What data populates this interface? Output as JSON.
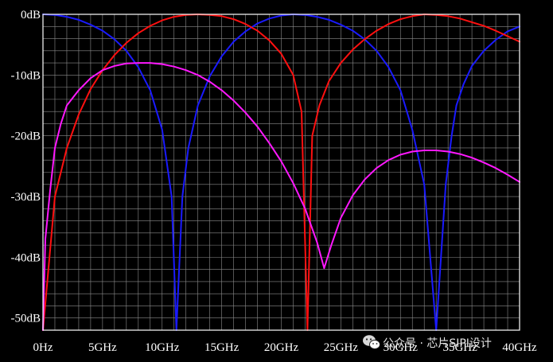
{
  "chart_data": {
    "type": "line",
    "title": "",
    "xlabel": "",
    "ylabel": "",
    "xlim": [
      0,
      40
    ],
    "ylim": [
      -52,
      0
    ],
    "x_unit": "GHz",
    "y_unit": "dB",
    "grid": true,
    "legend": "none",
    "x_ticks": [
      {
        "value": 0,
        "label": "0Hz"
      },
      {
        "value": 5,
        "label": "5GHz"
      },
      {
        "value": 10,
        "label": "10GHz"
      },
      {
        "value": 15,
        "label": "15GHz"
      },
      {
        "value": 20,
        "label": "20GHz"
      },
      {
        "value": 25,
        "label": "25GHz"
      },
      {
        "value": 30,
        "label": "30GHz"
      },
      {
        "value": 35,
        "label": "35GHz"
      },
      {
        "value": 40,
        "label": "40GHz"
      }
    ],
    "y_ticks": [
      {
        "value": 0,
        "label": "0dB"
      },
      {
        "value": -10,
        "label": "-10dB"
      },
      {
        "value": -20,
        "label": "-20dB"
      },
      {
        "value": -30,
        "label": "-30dB"
      },
      {
        "value": -40,
        "label": "-40dB"
      },
      {
        "value": -50,
        "label": "-50dB"
      }
    ],
    "series": [
      {
        "color": "#1a1aff",
        "x": [
          0,
          1,
          2,
          3,
          4,
          5,
          6,
          7,
          8,
          9,
          10,
          10.8,
          11.2,
          11.7,
          12.2,
          13,
          14,
          15,
          16,
          17,
          18,
          19,
          20,
          21,
          22,
          23,
          24,
          25,
          26,
          27,
          28,
          29,
          30,
          31,
          32,
          33,
          33.8,
          34.3,
          34.7,
          35.3,
          36,
          37,
          38,
          39,
          40
        ],
        "y": [
          0,
          -0.1,
          -0.4,
          -0.9,
          -1.7,
          -2.7,
          -4.1,
          -6.0,
          -8.7,
          -12.5,
          -19.0,
          -30.0,
          -52,
          -30.0,
          -22.0,
          -15.0,
          -10.2,
          -6.9,
          -4.5,
          -2.8,
          -1.5,
          -0.7,
          -0.2,
          0,
          -0.1,
          -0.4,
          -0.9,
          -1.7,
          -2.7,
          -4.1,
          -6.0,
          -8.7,
          -12.5,
          -19.0,
          -28.0,
          -52,
          -28.0,
          -20.0,
          -15.0,
          -11.5,
          -8.5,
          -6.0,
          -4.2,
          -2.8,
          -2.0
        ]
      },
      {
        "color": "#ff1010",
        "x": [
          0,
          1,
          2,
          3,
          4,
          5,
          6,
          7,
          8,
          9,
          10,
          11,
          12,
          13,
          14,
          15,
          16,
          17,
          18,
          19,
          20,
          21,
          21.7,
          22.2,
          22.6,
          23.2,
          24,
          25,
          26,
          27,
          28,
          29,
          30,
          31,
          32,
          33,
          34,
          35,
          36,
          37,
          38,
          39,
          40
        ],
        "y": [
          -52,
          -30.0,
          -22.0,
          -16.5,
          -12.3,
          -9.2,
          -6.7,
          -4.7,
          -3.1,
          -1.9,
          -1.0,
          -0.4,
          -0.1,
          0,
          -0.1,
          -0.3,
          -0.8,
          -1.6,
          -2.7,
          -4.3,
          -6.5,
          -10.0,
          -16.0,
          -52,
          -20.0,
          -15.0,
          -11.0,
          -8.0,
          -5.8,
          -4.1,
          -2.7,
          -1.6,
          -0.8,
          -0.3,
          0,
          -0.1,
          -0.3,
          -0.7,
          -1.3,
          -1.9,
          -2.7,
          -3.6,
          -4.5
        ]
      },
      {
        "color": "#ff18ff",
        "x": [
          0,
          0.2,
          0.6,
          1,
          1.5,
          2,
          3,
          4,
          5,
          6,
          7,
          8,
          9,
          10,
          11,
          12,
          13,
          14,
          15,
          16,
          17,
          18,
          19,
          20,
          21,
          22,
          23,
          23.6,
          24.2,
          25,
          26,
          27,
          28,
          29,
          30,
          31,
          32,
          33,
          34,
          35,
          36,
          37,
          38,
          39,
          40
        ],
        "y": [
          -52,
          -37.0,
          -29.0,
          -22.0,
          -18.0,
          -15.0,
          -12.5,
          -10.5,
          -9.2,
          -8.5,
          -8.1,
          -8.0,
          -8.0,
          -8.2,
          -8.6,
          -9.2,
          -10.0,
          -11.1,
          -12.5,
          -14.2,
          -16.2,
          -18.5,
          -21.2,
          -24.2,
          -27.8,
          -32.0,
          -37.5,
          -41.8,
          -38.0,
          -33.5,
          -29.8,
          -27.2,
          -25.3,
          -24.0,
          -23.1,
          -22.6,
          -22.4,
          -22.4,
          -22.6,
          -23.0,
          -23.6,
          -24.4,
          -25.3,
          -26.4,
          -27.6
        ]
      }
    ]
  },
  "watermark": {
    "icon": "wechat-icon",
    "text": "公众号 · 芯片SIPI设计"
  },
  "colors": {
    "background": "#000000",
    "frame": "#ffffff",
    "grid": "#8c8c8c",
    "text": "#ffffff"
  }
}
